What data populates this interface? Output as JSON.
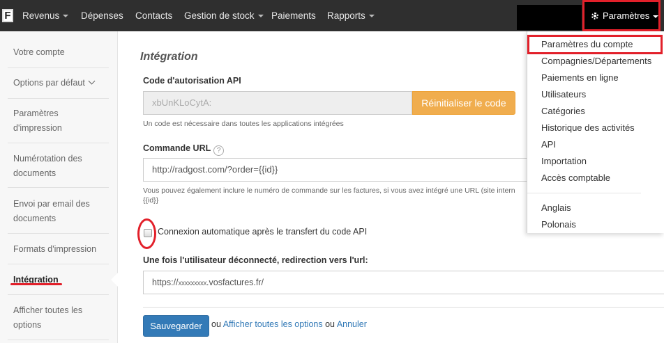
{
  "navbar": {
    "logo": "F",
    "items": [
      {
        "label": "Revenus",
        "caret": true
      },
      {
        "label": "Dépenses",
        "caret": false
      },
      {
        "label": "Contacts",
        "caret": false
      },
      {
        "label": "Gestion de stock",
        "caret": true
      },
      {
        "label": "Paiements",
        "caret": false
      },
      {
        "label": "Rapports",
        "caret": true
      }
    ],
    "settings_label": "Paramètres"
  },
  "sidebar": {
    "items": [
      {
        "label": "Votre compte"
      },
      {
        "label": "Options par défaut"
      },
      {
        "label": "Paramètres d'impression"
      },
      {
        "label": "Numérotation des documents"
      },
      {
        "label": "Envoi par email des documents"
      },
      {
        "label": "Formats d'impression"
      },
      {
        "label": "Intégration"
      },
      {
        "label": "Afficher toutes les options"
      }
    ],
    "active_index": 6
  },
  "main": {
    "title": "Intégration",
    "api_code": {
      "label": "Code d'autorisation API",
      "value": "xbUnKLoCytA:",
      "reset_button": "Réinitialiser le code",
      "help": "Un code est nécessaire dans toutes les applications intégrées"
    },
    "url_command": {
      "label": "Commande URL",
      "help_icon": "?",
      "value": "http://radgost.com/?order={{id}}",
      "help_line1": "Vous pouvez également inclure le numéro de commande sur les factures, si vous avez intégré une URL (site intern",
      "help_line2": "{{id}}"
    },
    "auto_login": {
      "label": "Connexion automatique après le transfert du code API",
      "checked": false
    },
    "logout_redirect": {
      "label": "Une fois l'utilisateur déconnecté, redirection vers l'url:",
      "value_prefix": "https://",
      "value_masked": "xxxxxxxxx",
      "value_suffix": ".vosfactures.fr/"
    },
    "actions": {
      "save": "Sauvegarder",
      "or1": "ou",
      "show_all": "Afficher toutes les options",
      "or2": "ou",
      "cancel": "Annuler"
    }
  },
  "dropdown": {
    "items": [
      {
        "label": "Paramètres du compte"
      },
      {
        "label": "Compagnies/Départements"
      },
      {
        "label": "Paiements en ligne"
      },
      {
        "label": "Utilisateurs"
      },
      {
        "label": "Catégories"
      },
      {
        "label": "Historique des activités"
      },
      {
        "label": "API"
      },
      {
        "label": "Importation"
      },
      {
        "label": "Accès comptable"
      }
    ],
    "languages": [
      {
        "label": "Anglais"
      },
      {
        "label": "Polonais"
      }
    ]
  },
  "colors": {
    "navbar_bg": "#2f2f2f",
    "annotation_red": "#e2202a",
    "orange_button": "#f0ad4e",
    "primary_blue": "#337ab7"
  }
}
